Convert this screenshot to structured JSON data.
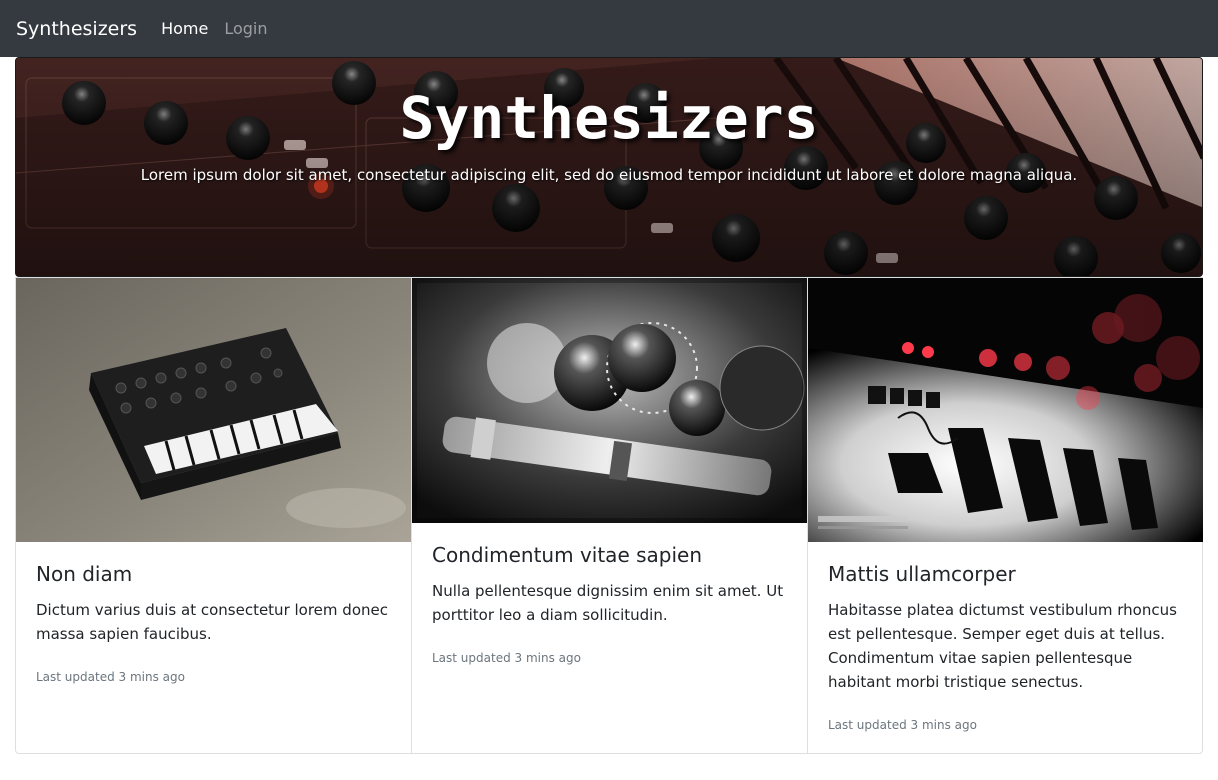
{
  "nav": {
    "brand": "Synthesizers",
    "links": [
      {
        "label": "Home",
        "active": true
      },
      {
        "label": "Login",
        "active": false
      }
    ]
  },
  "hero": {
    "title": "Synthesizers",
    "subtitle": "Lorem ipsum dolor sit amet, consectetur adipiscing elit, sed do eiusmod tempor incididunt ut labore et dolore magna aliqua."
  },
  "cards": [
    {
      "title": "Non diam",
      "text": "Dictum varius duis at consectetur lorem donec massa sapien faucibus.",
      "updated": "Last updated 3 mins ago"
    },
    {
      "title": "Condimentum vitae sapien",
      "text": "Nulla pellentesque dignissim enim sit amet. Ut porttitor leo a diam sollicitudin.",
      "updated": "Last updated 3 mins ago"
    },
    {
      "title": "Mattis ullamcorper",
      "text": "Habitasse platea dictumst vestibulum rhoncus est pellentesque. Semper eget duis at tellus. Condimentum vitae sapien pellentesque habitant morbi tristique senectus.",
      "updated": "Last updated 3 mins ago"
    }
  ],
  "colors": {
    "navbar": "#343a40",
    "muted_text": "#6c757d",
    "border": "#dfdfdf"
  }
}
